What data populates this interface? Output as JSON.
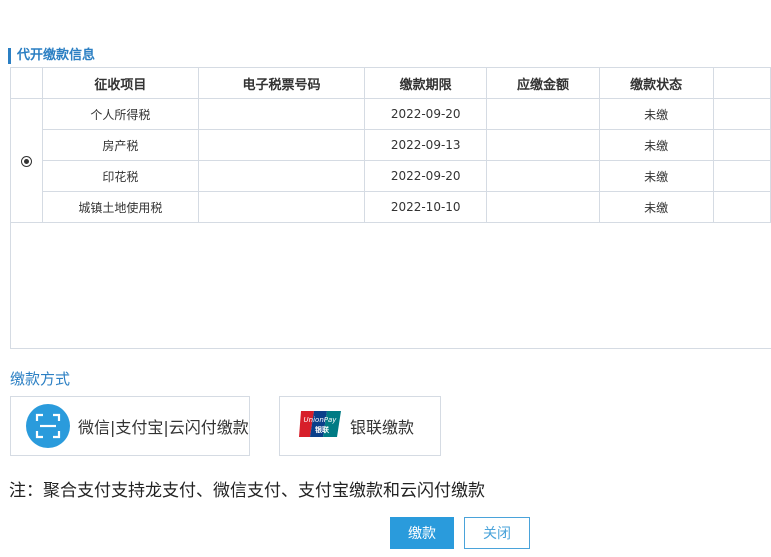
{
  "section": {
    "title": "代开缴款信息"
  },
  "table": {
    "headers": [
      "征收项目",
      "电子税票号码",
      "缴款期限",
      "应缴金额",
      "缴款状态"
    ],
    "rows": [
      {
        "item": "个人所得税",
        "ticket_no": "",
        "deadline": "2022-09-20",
        "amount": "",
        "status": "未缴"
      },
      {
        "item": "房产税",
        "ticket_no": "",
        "deadline": "2022-09-13",
        "amount": "",
        "status": "未缴"
      },
      {
        "item": "印花税",
        "ticket_no": "",
        "deadline": "2022-09-20",
        "amount": "",
        "status": "未缴"
      },
      {
        "item": "城镇土地使用税",
        "ticket_no": "",
        "deadline": "2022-10-10",
        "amount": "",
        "status": "未缴"
      }
    ]
  },
  "payment": {
    "title": "缴款方式",
    "options": [
      {
        "label": "微信|支付宝|云闪付缴款",
        "icon": "scan-icon"
      },
      {
        "label": "银联缴款",
        "icon": "unionpay-logo",
        "logo_text_top": "UnionPay",
        "logo_text_bottom": "银联"
      }
    ]
  },
  "note": "注：聚合支付支持龙支付、微信支付、支付宝缴款和云闪付缴款",
  "buttons": {
    "pay": "缴款",
    "close": "关闭"
  },
  "colors": {
    "accent": "#2b7fc3",
    "primary_button": "#2a9bdc",
    "border": "#d5dbe3"
  }
}
